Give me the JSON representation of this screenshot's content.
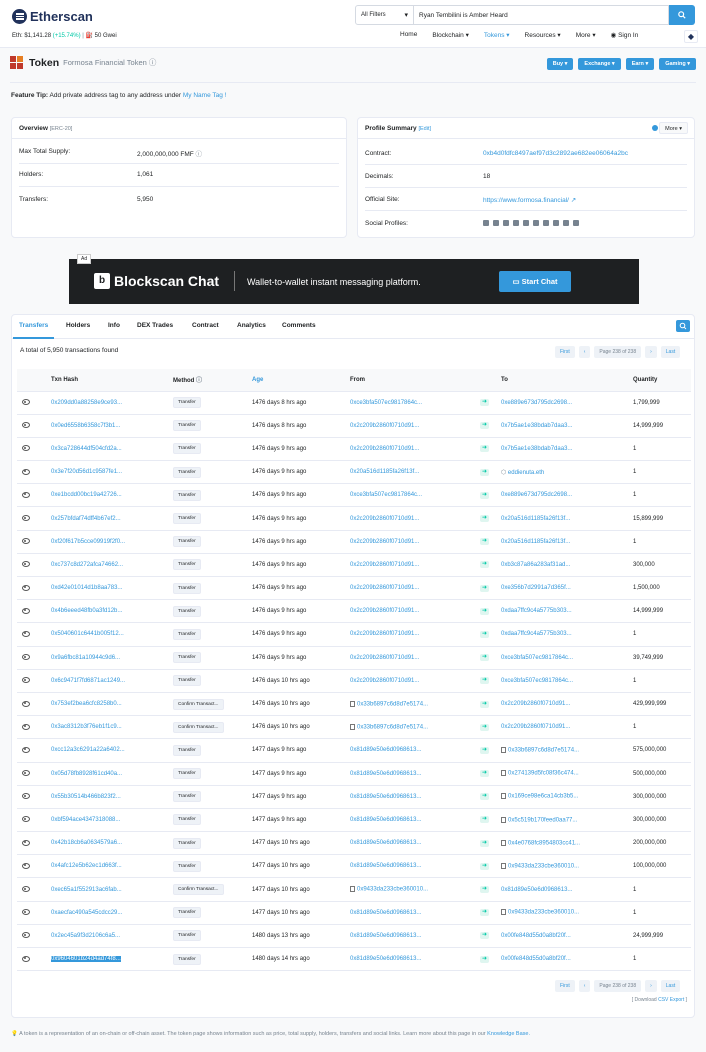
{
  "header": {
    "logo_text": "Etherscan",
    "eth_price_label": "Eth: $1,141.28",
    "eth_change": "(+15.74%)",
    "gas": "50 Gwei",
    "search_filter": "All Filters",
    "search_value": "Ryan Tembilini is Amber Heard",
    "nav": [
      "Home",
      "Blockchain",
      "Tokens",
      "Resources",
      "More",
      "Sign In"
    ]
  },
  "token": {
    "title": "Token",
    "name": "Formosa Financial Token",
    "buttons": [
      "Buy",
      "Exchange",
      "Earn",
      "Gaming"
    ]
  },
  "tip": {
    "label": "Feature Tip:",
    "text": " Add private address tag to any address under ",
    "link": "My Name Tag !"
  },
  "overview": {
    "title": "Overview",
    "badge": "[ERC-20]",
    "rows": [
      {
        "k": "Max Total Supply:",
        "v": "2,000,000,000 FMF"
      },
      {
        "k": "Holders:",
        "v": "1,061"
      },
      {
        "k": "Transfers:",
        "v": "5,950"
      }
    ]
  },
  "profile": {
    "title": "Profile Summary",
    "edit": "[Edit]",
    "more": "More",
    "rows": [
      {
        "k": "Contract:",
        "v": "0xb4d0fdfc8497aef97d3c2892ae682ee06064a2bc"
      },
      {
        "k": "Decimals:",
        "v": "18"
      },
      {
        "k": "Official Site:",
        "v": "https://www.formosa.financial/"
      },
      {
        "k": "Social Profiles:",
        "v": ""
      }
    ]
  },
  "ad": {
    "tag": "Ad",
    "name": "Blockscan Chat",
    "tagline": "Wallet-to-wallet instant messaging platform.",
    "cta": "Start Chat"
  },
  "tabs": [
    "Transfers",
    "Holders",
    "Info",
    "DEX Trades",
    "Contract",
    "Analytics",
    "Comments"
  ],
  "total_text": "A total of 5,950 transactions found",
  "pager": {
    "first": "First",
    "page": "Page 238 of 238",
    "last": "Last"
  },
  "columns": [
    "",
    "Txn Hash",
    "Method",
    "Age",
    "From",
    "",
    "To",
    "Quantity"
  ],
  "rows": [
    {
      "h": "0x209dd0a88258e9ce93...",
      "m": "Transfer",
      "a": "1476 days 8 hrs ago",
      "f": "0xce3bfa507ec9817864c...",
      "t": "0xe889e673d795dc2698...",
      "q": "1,799,999"
    },
    {
      "h": "0x0ed6558b6358c7f3b1...",
      "m": "Transfer",
      "a": "1476 days 8 hrs ago",
      "f": "0x2c209b2860f0710d91...",
      "t": "0x7b5ae1e38bdab7daa3...",
      "q": "14,999,999"
    },
    {
      "h": "0x3ca728644df504cfd2a...",
      "m": "Transfer",
      "a": "1476 days 9 hrs ago",
      "f": "0x2c209b2860f0710d91...",
      "t": "0x7b5ae1e38bdab7daa3...",
      "q": "1"
    },
    {
      "h": "0x3e7f20d56d1c9587fe1...",
      "m": "Transfer",
      "a": "1476 days 9 hrs ago",
      "f": "0x20a516d1185fa26f13f...",
      "t": "eddienuta.eth",
      "q": "1"
    },
    {
      "h": "0xe1bcdd00bc19a42726...",
      "m": "Transfer",
      "a": "1476 days 9 hrs ago",
      "f": "0xce3bfa507ec9817864c...",
      "t": "0xe889e673d795dc2698...",
      "q": "1"
    },
    {
      "h": "0x257bfdaf74dff4b67ef2...",
      "m": "Transfer",
      "a": "1476 days 9 hrs ago",
      "f": "0x2c209b2860f0710d91...",
      "t": "0x20a516d1185fa26f13f...",
      "q": "15,899,999"
    },
    {
      "h": "0xf20f617b5cce09919f2f0...",
      "m": "Transfer",
      "a": "1476 days 9 hrs ago",
      "f": "0x2c209b2860f0710d91...",
      "t": "0x20a516d1185fa26f13f...",
      "q": "1"
    },
    {
      "h": "0xc737c8d272afca74662...",
      "m": "Transfer",
      "a": "1476 days 9 hrs ago",
      "f": "0x2c209b2860f0710d91...",
      "t": "0xb3c87a86a283af31ad...",
      "q": "300,000"
    },
    {
      "h": "0xd42e01014d1b8aa783...",
      "m": "Transfer",
      "a": "1476 days 9 hrs ago",
      "f": "0x2c209b2860f0710d91...",
      "t": "0xe356b7d2991a7d365f...",
      "q": "1,500,000"
    },
    {
      "h": "0x4b6eeed48fb0a3fd12b...",
      "m": "Transfer",
      "a": "1476 days 9 hrs ago",
      "f": "0x2c209b2860f0710d91...",
      "t": "0xdaa7ffc9c4a5775b303...",
      "q": "14,999,999"
    },
    {
      "h": "0x5040601c6441b005f12...",
      "m": "Transfer",
      "a": "1476 days 9 hrs ago",
      "f": "0x2c209b2860f0710d91...",
      "t": "0xdaa7ffc9c4a5775b303...",
      "q": "1"
    },
    {
      "h": "0x9a6fbc81a10944c9d6...",
      "m": "Transfer",
      "a": "1476 days 9 hrs ago",
      "f": "0x2c209b2860f0710d91...",
      "t": "0xce3bfa507ec9817864c...",
      "q": "39,749,999"
    },
    {
      "h": "0x6c9471f7fd6871ac1249...",
      "m": "Transfer",
      "a": "1476 days 10 hrs ago",
      "f": "0x2c209b2860f0710d91...",
      "t": "0xce3bfa507ec9817864c...",
      "q": "1"
    },
    {
      "h": "0x753ef2bea6cfc8258b0...",
      "m": "Confirm Transact...",
      "a": "1476 days 10 hrs ago",
      "f": "0x33b6897c6d8d7e5174...",
      "t": "0x2c209b2860f0710d91...",
      "q": "429,999,999",
      "fd": true
    },
    {
      "h": "0x3ac8312b3f76eb1f1c9...",
      "m": "Confirm Transact...",
      "a": "1476 days 10 hrs ago",
      "f": "0x33b6897c6d8d7e5174...",
      "t": "0x2c209b2860f0710d91...",
      "q": "1",
      "fd": true
    },
    {
      "h": "0xcc12a3c6291a22a6402...",
      "m": "Transfer",
      "a": "1477 days 9 hrs ago",
      "f": "0x81d89e50e6d0968613...",
      "t": "0x33b6897c6d8d7e5174...",
      "q": "575,000,000",
      "td": true
    },
    {
      "h": "0x05d78fb8928f61cd40a...",
      "m": "Transfer",
      "a": "1477 days 9 hrs ago",
      "f": "0x81d89e50e6d0968613...",
      "t": "0x274139d5fc08f36c474...",
      "q": "500,000,000",
      "td": true
    },
    {
      "h": "0x55b30514b466b823f2...",
      "m": "Transfer",
      "a": "1477 days 9 hrs ago",
      "f": "0x81d89e50e6d0968613...",
      "t": "0x169ce98e6ca14cb3b5...",
      "q": "300,000,000",
      "td": true
    },
    {
      "h": "0xbf594ace4347318088...",
      "m": "Transfer",
      "a": "1477 days 9 hrs ago",
      "f": "0x81d89e50e6d0968613...",
      "t": "0x5c519b170feed0aa77...",
      "q": "300,000,000",
      "td": true
    },
    {
      "h": "0x42b18cb6a0634579a6...",
      "m": "Transfer",
      "a": "1477 days 10 hrs ago",
      "f": "0x81d89e50e6d0968613...",
      "t": "0x4e0768fc8954803cc41...",
      "q": "200,000,000",
      "td": true
    },
    {
      "h": "0x4afc12e5b62ec1d663f...",
      "m": "Transfer",
      "a": "1477 days 10 hrs ago",
      "f": "0x81d89e50e6d0968613...",
      "t": "0x9433da233cbe360010...",
      "q": "100,000,000",
      "td": true
    },
    {
      "h": "0xec65a1f552913ac6fab...",
      "m": "Confirm Transact...",
      "a": "1477 days 10 hrs ago",
      "f": "0x9433da233cbe360010...",
      "t": "0x81d89e50e6d0968613...",
      "q": "1",
      "fd": true
    },
    {
      "h": "0xaecfac490a545cdcc29...",
      "m": "Transfer",
      "a": "1477 days 10 hrs ago",
      "f": "0x81d89e50e6d0968613...",
      "t": "0x9433da233cbe360010...",
      "q": "1",
      "td": true
    },
    {
      "h": "0x2ec45a9f3d2106c6a5...",
      "m": "Transfer",
      "a": "1480 days 13 hrs ago",
      "f": "0x81d89e50e6d0968613...",
      "t": "0x00fe848d55d0a8bf20f...",
      "q": "24,999,999"
    },
    {
      "h": "0x9604601b24d4ad74f8...",
      "m": "Transfer",
      "a": "1480 days 14 hrs ago",
      "f": "0x81d89e50e6d0968613...",
      "t": "0x00fe848d55d0a8bf20f...",
      "q": "1",
      "hl": true
    }
  ],
  "csv": {
    "prefix": "[ Download ",
    "link": "CSV Export",
    "suffix": " ]"
  },
  "footer": {
    "text": "A token is a representation of an on-chain or off-chain asset. The token page shows information such as price, total supply, holders, transfers and social links. Learn more about this page in our ",
    "link": "Knowledge Base."
  }
}
